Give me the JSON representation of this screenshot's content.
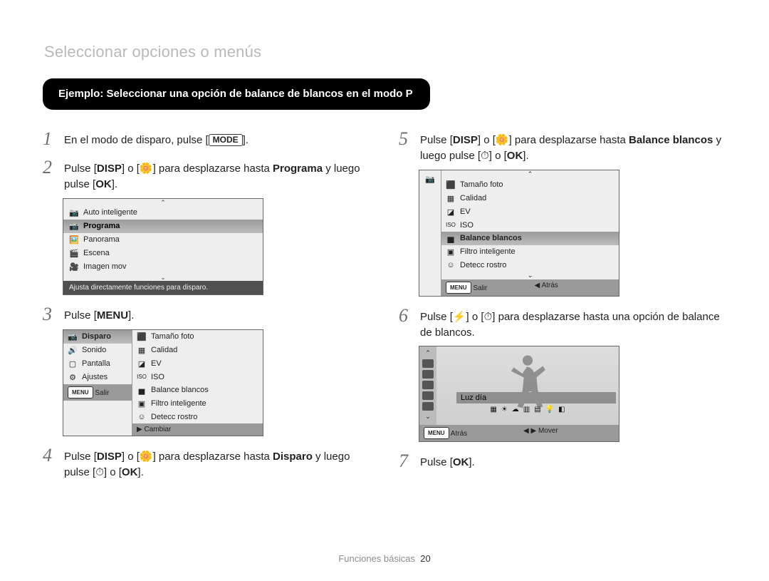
{
  "header": "Seleccionar opciones o menús",
  "example": "Ejemplo: Seleccionar una opción de balance de blancos en el modo P",
  "steps": {
    "s1": {
      "pre": "En el modo de disparo, pulse [",
      "key": "MODE",
      "post": "]."
    },
    "s2": {
      "a": "Pulse [",
      "disp": "DISP",
      "b": "] o [",
      "icon": "🌼",
      "c": "] para desplazarse hasta ",
      "prog": "Programa",
      "d": " y luego pulse [",
      "ok": "OK",
      "e": "]."
    },
    "s3": {
      "a": "Pulse [",
      "menu": "MENU",
      "b": "]."
    },
    "s4": {
      "a": "Pulse [",
      "disp": "DISP",
      "b": "] o [",
      "icon": "🌼",
      "c": "] para desplazarse hasta ",
      "disparo": "Disparo",
      "d": " y luego pulse [",
      "timer": "⏱",
      "e": "] o [",
      "ok": "OK",
      "f": "]."
    },
    "s5": {
      "a": "Pulse [",
      "disp": "DISP",
      "b": "] o [",
      "icon": "🌼",
      "c": "] para desplazarse hasta ",
      "bb": "Balance blancos",
      "d": " y luego pulse [",
      "timer": "⏱",
      "e": "] o [",
      "ok": "OK",
      "f": "]."
    },
    "s6": {
      "a": "Pulse [",
      "flash": "⚡",
      "b": "] o [",
      "timer": "⏱",
      "c": "] para desplazarse hasta una opción de balance de blancos."
    },
    "s7": {
      "a": "Pulse [",
      "ok": "OK",
      "b": "]."
    }
  },
  "lcd1": {
    "items": [
      "Auto inteligente",
      "Programa",
      "Panorama",
      "Escena",
      "Imagen mov"
    ],
    "selectedIndex": 1,
    "desc": "Ajusta directamente funciones para disparo."
  },
  "lcd2": {
    "left": [
      "Disparo",
      "Sonido",
      "Pantalla",
      "Ajustes"
    ],
    "leftSelected": 0,
    "right": [
      "Tamaño foto",
      "Calidad",
      "EV",
      "ISO",
      "Balance blancos",
      "Filtro inteligente",
      "Detecc rostro"
    ],
    "bar": {
      "menu": "MENU",
      "salir": "Salir",
      "arrow": "▶",
      "cambiar": "Cambiar"
    }
  },
  "lcd5": {
    "right": [
      "Tamaño foto",
      "Calidad",
      "EV",
      "ISO",
      "Balance blancos",
      "Filtro inteligente",
      "Detecc rostro"
    ],
    "selectedIndex": 4,
    "bar": {
      "menu": "MENU",
      "salir": "Salir",
      "arrow": "◀",
      "atras": "Atrás"
    }
  },
  "lcd6": {
    "label": "Luz día",
    "bar": {
      "menu": "MENU",
      "atras": "Atrás",
      "arrow": "◀ ▶",
      "mover": "Mover"
    }
  },
  "icons": {
    "camera": "📷",
    "wide": "🖼️",
    "scn": "🎬",
    "mov": "🎥",
    "size": "⬛",
    "quality": "▦",
    "ev": "◪",
    "iso": "ISO",
    "wb": "▅",
    "filter": "🖼",
    "face": "☺",
    "sound": "🔊",
    "screen": "▢",
    "settings": "⚙"
  },
  "footer": {
    "section": "Funciones básicas",
    "page": "20"
  }
}
